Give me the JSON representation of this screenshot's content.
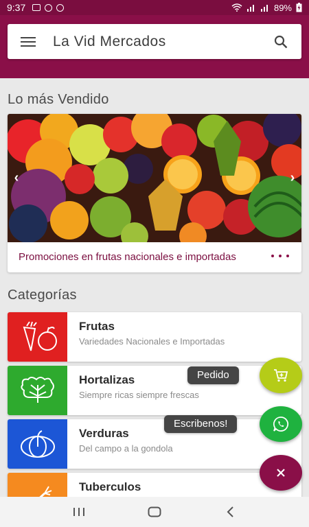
{
  "status_bar": {
    "time": "9:37",
    "battery": "89%"
  },
  "app_bar": {
    "title": "La Vid Mercados"
  },
  "best_sellers": {
    "title": "Lo más Vendido",
    "carousel": {
      "caption": "Promociones en frutas nacionales e importadas"
    }
  },
  "categories": {
    "title": "Categorías",
    "items": [
      {
        "name": "Frutas",
        "description": "Variedades Nacionales e Importadas",
        "color": "#e02020",
        "icon": "fruits-icon"
      },
      {
        "name": "Hortalizas",
        "description": "Siempre ricas siempre frescas",
        "color": "#2eaa2e",
        "icon": "lettuce-icon"
      },
      {
        "name": "Verduras",
        "description": "Del campo a la gondola",
        "color": "#1c56d6",
        "icon": "pumpkin-icon"
      },
      {
        "name": "Tuberculos",
        "description": "",
        "color": "#f58a1f",
        "icon": "carrot-icon"
      }
    ]
  },
  "fab": {
    "order_label": "Pedido",
    "whatsapp_label": "Escribenos!",
    "colors": {
      "order": "#b5cc18",
      "whatsapp": "#1fb23f",
      "close": "#8a0f48"
    }
  },
  "theme": {
    "primary": "#8a0f48",
    "status": "#7a0d3f"
  }
}
